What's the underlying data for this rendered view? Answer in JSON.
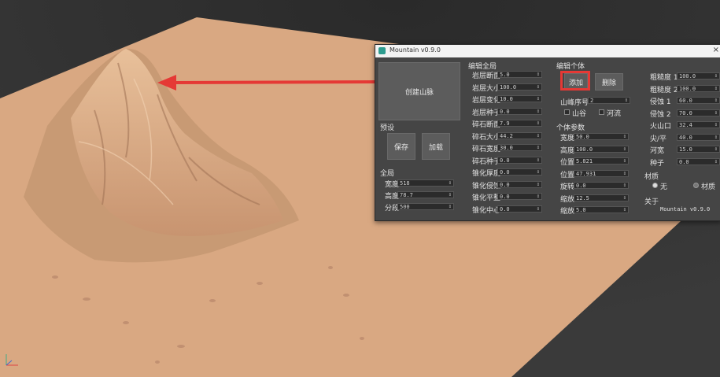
{
  "window": {
    "title": "Mountain v0.9.0"
  },
  "left": {
    "create_label": "创建山脉",
    "preset_title": "预设",
    "save_label": "保存",
    "load_label": "加载",
    "global_title": "全局",
    "global": [
      {
        "label": "宽度",
        "value": "518"
      },
      {
        "label": "高度",
        "value": "78.7"
      },
      {
        "label": "分段",
        "value": "500"
      }
    ]
  },
  "edit_global": {
    "title": "编辑全局",
    "fields": [
      {
        "label": "岩层断面",
        "value": "5.0"
      },
      {
        "label": "岩层大小",
        "value": "100.0"
      },
      {
        "label": "岩层变化",
        "value": "10.0"
      },
      {
        "label": "岩层种子",
        "value": "0.0"
      },
      {
        "label": "碎石断面",
        "value": "7.9"
      },
      {
        "label": "碎石大小",
        "value": "44.2"
      },
      {
        "label": "碎石宽度",
        "value": "30.0"
      },
      {
        "label": "碎石种子",
        "value": "0.0"
      },
      {
        "label": "锥化厚度",
        "value": "0.0"
      },
      {
        "label": "锥化侵蚀",
        "value": "0.0"
      },
      {
        "label": "锥化平整",
        "value": "0.0"
      },
      {
        "label": "锥化中心",
        "value": "0.0"
      }
    ]
  },
  "edit_individual": {
    "title": "编辑个体",
    "add_label": "添加",
    "delete_label": "删除",
    "ridge_index_label": "山峰序号",
    "ridge_index_value": "2",
    "valley_label": "山谷",
    "river_label": "河流",
    "params_title": "个体参数",
    "fields": [
      {
        "label": "宽度",
        "value": "50.0"
      },
      {
        "label": "高度",
        "value": "100.0"
      },
      {
        "label": "位置 X",
        "value": "5.821"
      },
      {
        "label": "位置 Y",
        "value": "47.931"
      },
      {
        "label": "旋转",
        "value": "0.0"
      },
      {
        "label": "缩放 1",
        "value": "12.5"
      },
      {
        "label": "缩放 2",
        "value": "5.0"
      }
    ]
  },
  "right": {
    "fields": [
      {
        "label": "粗糙度 1",
        "value": "100.0"
      },
      {
        "label": "粗糙度 2",
        "value": "100.0"
      },
      {
        "label": "侵蚀 1",
        "value": "60.0"
      },
      {
        "label": "侵蚀 2",
        "value": "70.0"
      },
      {
        "label": "火山口",
        "value": "32.4"
      },
      {
        "label": "尖/平",
        "value": "40.0"
      },
      {
        "label": "河宽",
        "value": "15.0"
      },
      {
        "label": "种子",
        "value": "0.0"
      }
    ],
    "material_title": "材质",
    "material_none": "无",
    "material_mat": "材质",
    "about_title": "关于",
    "about_text": "Mountain v0.9.0"
  },
  "colors": {
    "terrain": "#d9a882",
    "panel": "#454545",
    "highlight": "#e53935"
  }
}
